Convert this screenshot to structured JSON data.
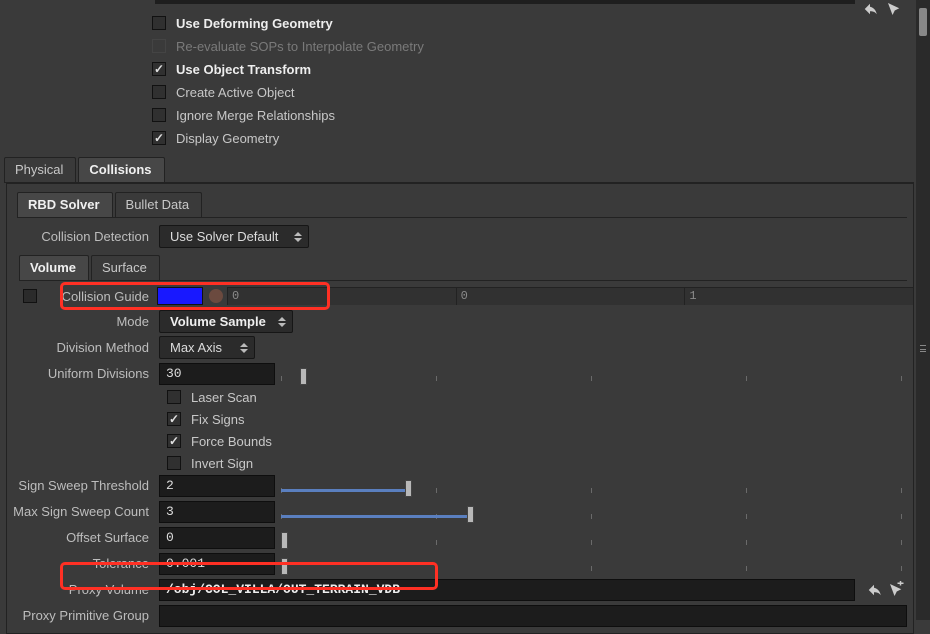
{
  "top": {
    "checks": [
      {
        "label": "Use Deforming Geometry",
        "checked": false,
        "disabled": false,
        "strong": true
      },
      {
        "label": "Re-evaluate SOPs to Interpolate Geometry",
        "checked": false,
        "disabled": true,
        "strong": false
      },
      {
        "label": "Use Object Transform",
        "checked": true,
        "disabled": false,
        "strong": true
      },
      {
        "label": "Create Active Object",
        "checked": false,
        "disabled": false,
        "strong": false
      },
      {
        "label": "Ignore Merge Relationships",
        "checked": false,
        "disabled": false,
        "strong": false
      },
      {
        "label": "Display Geometry",
        "checked": true,
        "disabled": false,
        "strong": false
      }
    ]
  },
  "tabs_main": {
    "t0": "Physical",
    "t1": "Collisions"
  },
  "tabs_inner": {
    "t0": "RBD Solver",
    "t1": "Bullet Data"
  },
  "tabs_sub": {
    "t0": "Volume",
    "t1": "Surface"
  },
  "collision_detection": {
    "label": "Collision Detection",
    "value": "Use Solver Default"
  },
  "guide": {
    "label": "Collision Guide",
    "color": "#1818FF",
    "c0": "0",
    "c1": "0",
    "c2": "1"
  },
  "mode": {
    "label": "Mode",
    "value": "Volume Sample"
  },
  "division_method": {
    "label": "Division Method",
    "value": "Max Axis"
  },
  "uniform_divisions": {
    "label": "Uniform Divisions",
    "value": "30"
  },
  "vol_checks": {
    "laser": {
      "label": "Laser Scan",
      "checked": false
    },
    "fix_signs": {
      "label": "Fix Signs",
      "checked": true
    },
    "force_bounds": {
      "label": "Force Bounds",
      "checked": true
    },
    "invert_sign": {
      "label": "Invert Sign",
      "checked": false
    }
  },
  "sign_sweep_threshold": {
    "label": "Sign Sweep Threshold",
    "value": "2"
  },
  "max_sign_sweep_count": {
    "label": "Max Sign Sweep Count",
    "value": "3"
  },
  "offset_surface": {
    "label": "Offset Surface",
    "value": "0"
  },
  "tolerance": {
    "label": "Tolerance",
    "value": "0.001"
  },
  "proxy_volume": {
    "label": "Proxy Volume",
    "value": "/obj/COL_VILLA/OUT_TERRAIN_VDB"
  },
  "proxy_prim_group": {
    "label": "Proxy Primitive Group",
    "value": ""
  }
}
